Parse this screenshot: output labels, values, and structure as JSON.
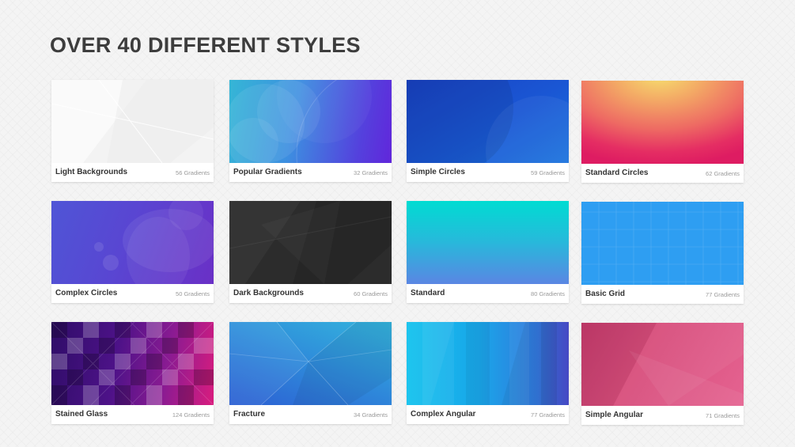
{
  "page": {
    "title": "OVER 40 DIFFERENT STYLES"
  },
  "cards": [
    {
      "name": "Light Backgrounds",
      "count": "56 Gradients"
    },
    {
      "name": "Popular Gradients",
      "count": "32 Gradients"
    },
    {
      "name": "Simple Circles",
      "count": "59 Gradients"
    },
    {
      "name": "Standard Circles",
      "count": "62 Gradients"
    },
    {
      "name": "Complex Circles",
      "count": "50 Gradients"
    },
    {
      "name": "Dark Backgrounds",
      "count": "60 Gradients"
    },
    {
      "name": "Standard",
      "count": "80 Gradients"
    },
    {
      "name": "Basic Grid",
      "count": "77 Gradients"
    },
    {
      "name": "Stained Glass",
      "count": "124 Gradients"
    },
    {
      "name": "Fracture",
      "count": "34 Gradients"
    },
    {
      "name": "Complex Angular",
      "count": "77 Gradients"
    },
    {
      "name": "Simple Angular",
      "count": "71 Gradients"
    }
  ],
  "colors": {
    "title": "#3d3d3d",
    "card_label": "#333333",
    "card_count": "#9a9a9a"
  }
}
